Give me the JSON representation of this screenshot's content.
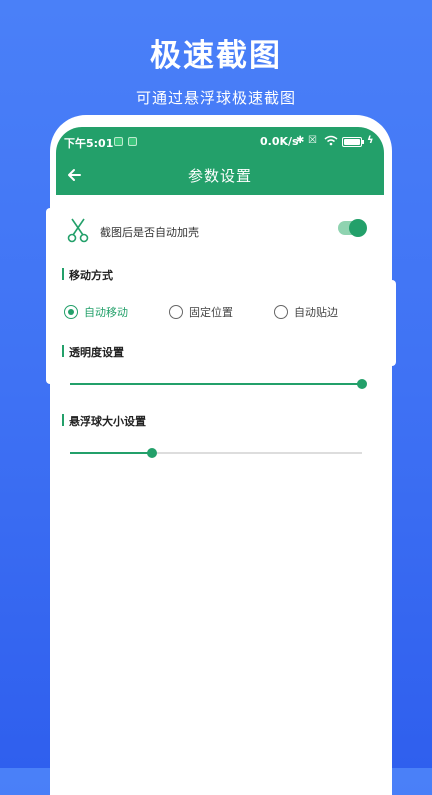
{
  "promo": {
    "title": "极速截图",
    "subtitle": "可通过悬浮球极速截图"
  },
  "status_bar": {
    "time": "下午5:01",
    "net_speed": "0.0K/s",
    "icons": [
      "app-notification-icon",
      "app-notification-icon",
      "bluetooth-icon",
      "sim-x-icon",
      "wifi-icon",
      "battery-icon",
      "charging-icon"
    ],
    "battery_level": 100
  },
  "toolbar": {
    "back_icon": "arrow-left-icon",
    "title": "参数设置"
  },
  "auto_shell": {
    "icon": "scissors-icon",
    "label": "截图后是否自动加壳",
    "enabled": true
  },
  "move_mode": {
    "title": "移动方式",
    "options": [
      {
        "label": "自动移动",
        "selected": true
      },
      {
        "label": "固定位置",
        "selected": false
      },
      {
        "label": "自动贴边",
        "selected": false
      }
    ]
  },
  "opacity": {
    "title": "透明度设置",
    "value_fraction": 1.0
  },
  "ball_size": {
    "title": "悬浮球大小设置",
    "value_fraction": 0.28
  },
  "colors": {
    "accent": "#23a06a",
    "background": "#3f72f4"
  }
}
